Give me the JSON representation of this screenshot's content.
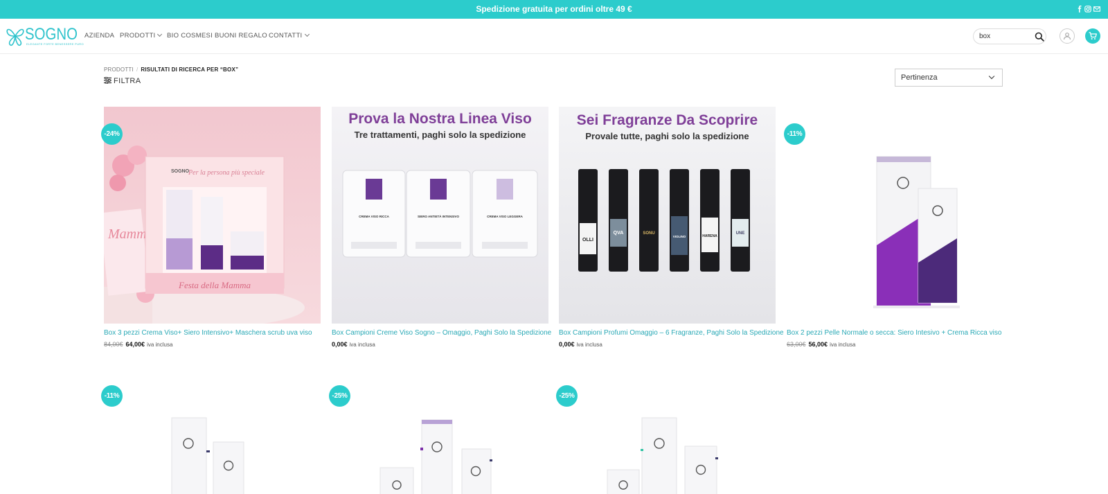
{
  "topbar": {
    "message": "Spedizione gratuita per ordini oltre 49 €",
    "social_icons": [
      "facebook-icon",
      "instagram-icon",
      "email-icon"
    ]
  },
  "brand": {
    "name": "SOGNO",
    "tagline": "ELEGANTE FORTE BENESSERE PURO",
    "accent_color": "#2ccccc"
  },
  "nav": {
    "items": [
      {
        "label": "AZIENDA",
        "has_dropdown": false
      },
      {
        "label": "PRODOTTI",
        "has_dropdown": true
      },
      {
        "label": "BIO COSMESI",
        "has_dropdown": false
      },
      {
        "label": "BUONI REGALO",
        "has_dropdown": false
      },
      {
        "label": "CONTATTI",
        "has_dropdown": true
      }
    ]
  },
  "search": {
    "value": "box",
    "icon": "search-icon"
  },
  "header_actions": {
    "account_icon": "user-icon",
    "cart_icon": "cart-icon"
  },
  "breadcrumb": {
    "root": "PRODOTTI",
    "separator": "/",
    "current": "RISULTATI DI RICERCA PER “BOX”"
  },
  "filter": {
    "label": "FILTRA",
    "icon": "filter-icon"
  },
  "sort": {
    "selected": "Pertinenza"
  },
  "products": [
    {
      "badge": "-24%",
      "title": "Box 3 pezzi Crema Viso+ Siero Intensivo+ Maschera scrub uva viso",
      "price_old": "84,00€",
      "price": "64,00€",
      "vat": "iva inclusa",
      "image": {
        "type": "giftbox",
        "caption_left": "Mamma",
        "caption_box": "Festa della Mamma",
        "caption_top": "Per la persona più speciale"
      }
    },
    {
      "badge": "",
      "title": "Box Campioni Creme Viso Sogno – Omaggio, Paghi Solo la Spedizione",
      "price_old": "",
      "price": "0,00€",
      "vat": "iva inclusa",
      "image": {
        "type": "sachets",
        "headline": "Prova la Nostra Linea Viso",
        "subline": "Tre trattamenti, paghi solo la spedizione",
        "sachet_labels": [
          "CREMA VISO RICCA",
          "SIERO ANTIETÀ INTENSIVO",
          "CREMA VISO LEGGERA"
        ]
      }
    },
    {
      "badge": "",
      "title": "Box Campioni Profumi Omaggio – 6 Fragranze, Paghi Solo la Spedizione",
      "price_old": "",
      "price": "0,00€",
      "vat": "iva inclusa",
      "image": {
        "type": "perfumes",
        "headline": "Sei Fragranze Da Scoprire",
        "subline": "Provale tutte, paghi solo la spedizione",
        "vial_labels": [
          "OLLI",
          "QVA",
          "SONU",
          "VIOLINO",
          "HARENA",
          "UNE"
        ]
      }
    },
    {
      "badge": "-11%",
      "title": "Box 2 pezzi Pelle Normale o secca: Siero Intesivo + Crema Ricca viso",
      "price_old": "63,00€",
      "price": "56,00€",
      "vat": "iva inclusa",
      "image": {
        "type": "duo",
        "accent": "#7b2fa8"
      }
    },
    {
      "badge": "-11%",
      "title": "",
      "price_old": "",
      "price": "",
      "vat": "",
      "image": {
        "type": "duo-light"
      }
    },
    {
      "badge": "-25%",
      "title": "",
      "price_old": "",
      "price": "",
      "vat": "",
      "image": {
        "type": "trio"
      }
    },
    {
      "badge": "-25%",
      "title": "",
      "price_old": "",
      "price": "",
      "vat": "",
      "image": {
        "type": "trio-light"
      }
    }
  ]
}
